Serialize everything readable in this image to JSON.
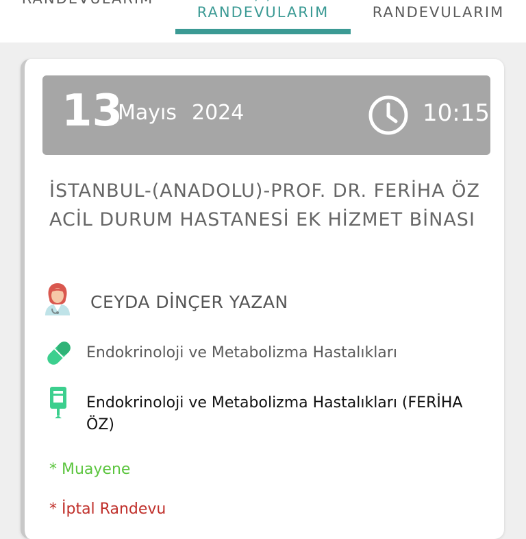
{
  "tabs": [
    {
      "label": "RANDEVULARIM"
    },
    {
      "label": "RANDEVULARIM",
      "peek": "‚ ‚"
    },
    {
      "label": "RANDEVULARIM"
    }
  ],
  "appointment": {
    "day": "13",
    "month": "Mayıs",
    "year": "2024",
    "time": "10:15",
    "hospital": "İSTANBUL-(ANADOLU)-PROF. DR. FERİHA ÖZ ACİL DURUM HASTANESİ EK HİZMET BİNASI",
    "doctor": "CEYDA DİNÇER YAZAN",
    "branch": "Endokrinoloji ve Metabolizma Hastalıkları",
    "clinic": "Endokrinoloji ve Metabolizma Hastalıkları (FERİHA ÖZ)",
    "options": {
      "exam": "* Muayene",
      "cancel": "* İptal Randevu"
    }
  },
  "colors": {
    "accent": "#3b9a94",
    "banner": "#a6a6a6",
    "pill": "#3ccf8e",
    "exam": "#5cc53f",
    "cancel": "#c0302b"
  },
  "icons": [
    "clock-icon",
    "doctor-avatar-icon",
    "pill-icon",
    "clinic-icon"
  ]
}
